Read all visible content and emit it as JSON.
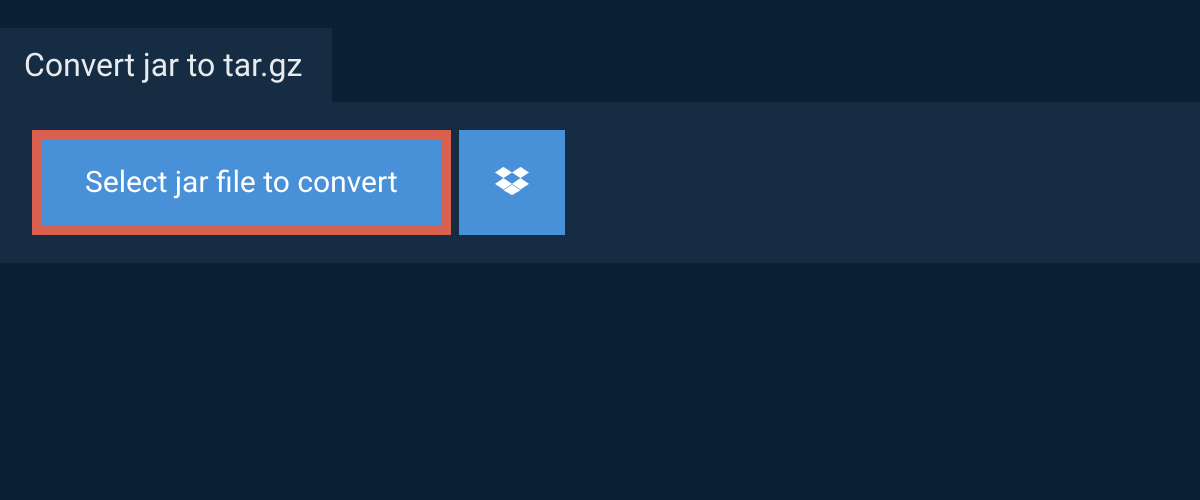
{
  "header": {
    "title": "Convert jar to tar.gz"
  },
  "actions": {
    "select_file_label": "Select jar file to convert"
  },
  "colors": {
    "page_bg": "#0c2035",
    "panel_bg": "#152c42",
    "button_bg": "#4890d8",
    "highlight_border": "#d9604f"
  }
}
